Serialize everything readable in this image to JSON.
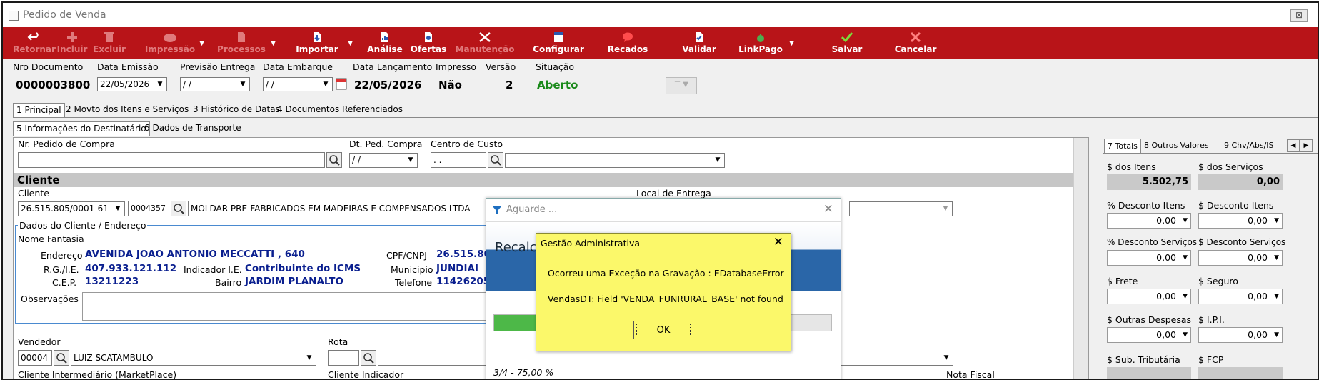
{
  "window": {
    "title": "Pedido de Venda",
    "close_glyph": "⊠"
  },
  "toolbar": {
    "retornar": "Retornar",
    "incluir": "Incluir",
    "excluir": "Excluir",
    "impressao": "Impressão",
    "processos": "Processos",
    "importar": "Importar",
    "analise": "Análise",
    "ofertas": "Ofertas",
    "manutencao": "Manutenção",
    "configurar": "Configurar",
    "recados": "Recados",
    "validar": "Validar",
    "linkpago": "LinkPago",
    "salvar": "Salvar",
    "cancelar": "Cancelar"
  },
  "header": {
    "nro_documento_label": "Nro Documento",
    "nro_documento": "0000003800",
    "data_emissao_label": "Data Emissão",
    "data_emissao": "22/05/2026",
    "previsao_label": "Previsão Entrega",
    "previsao": "/ /",
    "data_embarque_label": "Data Embarque",
    "data_embarque": "/ /",
    "data_lancamento_label": "Data Lançamento",
    "data_lancamento": "22/05/2026",
    "impresso_label": "Impresso",
    "impresso": "Não",
    "versao_label": "Versão",
    "versao": "2",
    "situacao_label": "Situação",
    "situacao": "Aberto"
  },
  "tabs_main": [
    "1 Principal",
    "2 Movto dos Itens e Serviços",
    "3 Histórico de Datas",
    "4 Documentos Referenciados"
  ],
  "tabs_sub": [
    "5 Informações do Destinatário",
    "6 Dados de Transporte"
  ],
  "form": {
    "nr_pedido_label": "Nr. Pedido de Compra",
    "dt_ped_label": "Dt. Ped. Compra",
    "dt_ped": "/ /",
    "centro_custo_label": "Centro de Custo",
    "centro_custo": ". .",
    "cliente_section": "Cliente",
    "cliente_label": "Cliente",
    "cliente_cnpj": "26.515.805/0001-61",
    "cliente_codigo": "0004357",
    "cliente_nome": "MOLDAR PRE-FABRICADOS EM MADEIRAS E COMPENSADOS LTDA",
    "local_entrega_label": "Local de Entrega",
    "dados_label": "Dados do Cliente / Endereço",
    "nome_fantasia_label": "Nome Fantasia",
    "endereco_label": "Endereço",
    "endereco": "AVENIDA JOAO ANTONIO MECCATTI , 640",
    "rg_label": "R.G./I.E.",
    "rg": "407.933.121.112",
    "indicador_label": "Indicador I.E.",
    "indicador": "Contribuinte do ICMS",
    "cep_label": "C.E.P.",
    "cep": "13211223",
    "bairro_label": "Bairro",
    "bairro": "JARDIM PLANALTO",
    "cpf_label": "CPF/CNPJ",
    "cpf": "26.515.805",
    "municipio_label": "Municipio",
    "municipio": "JUNDIAI",
    "telefone_label": "Telefone",
    "telefone": "114262053",
    "observacoes_label": "Observações",
    "vendedor_label": "Vendedor",
    "vendedor_codigo": "00004",
    "vendedor_nome": "LUIZ SCATAMBULO",
    "rota_label": "Rota",
    "cliente_intermediario_label": "Cliente Intermediário (MarketPlace)",
    "cliente_indicador_label": "Cliente Indicador",
    "nota_fiscal_label": "Nota Fiscal"
  },
  "right": {
    "tabs": [
      "7 Totais",
      "8 Outros Valores",
      "9 Chv/Abs/IS"
    ],
    "dos_itens_label": "$ dos Itens",
    "dos_itens": "5.502,75",
    "dos_servicos_label": "$ dos Serviços",
    "dos_servicos": "0,00",
    "desc_itens_pct_label": "% Desconto Itens",
    "desc_itens_pct": "0,00",
    "desc_itens_val_label": "$ Desconto Itens",
    "desc_itens_val": "0,00",
    "desc_serv_pct_label": "% Desconto Serviços",
    "desc_serv_pct": "0,00",
    "desc_serv_val_label": "$ Desconto Serviços",
    "desc_serv_val": "0,00",
    "frete_label": "$ Frete",
    "frete": "0,00",
    "seguro_label": "$ Seguro",
    "seguro": "0,00",
    "outras_label": "$ Outras Despesas",
    "outras": "0,00",
    "ipi_label": "$ I.P.I.",
    "ipi": "0,00",
    "sub_trib_label": "$ Sub. Tributária",
    "fcp_label": "$ FCP"
  },
  "wait": {
    "title": "Aguarde ...",
    "recalc": "Recalcu",
    "progress_text": "3/4 - 75,00 %",
    "progress_fraction": 0.75
  },
  "dialog": {
    "title": "Gestão Administrativa",
    "message1": "Ocorreu uma Exceção na Gravação : EDatabaseError",
    "message2": "VendasDT: Field 'VENDA_FUNRURAL_BASE' not found",
    "ok": "OK"
  },
  "colors": {
    "toolbar": "#b81418",
    "situacao": "#1a8a1a",
    "dialog_bg": "#fbf86a",
    "wait_header": "#2a66a8"
  }
}
